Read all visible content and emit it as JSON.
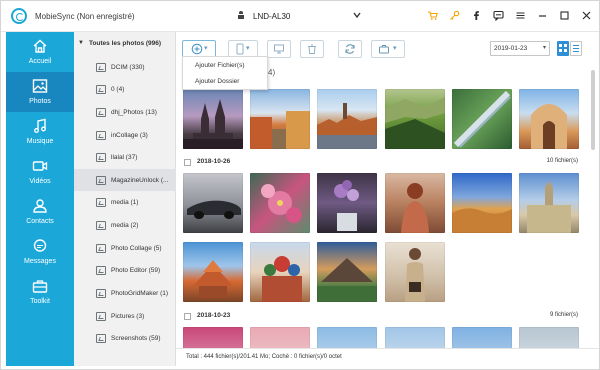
{
  "app": {
    "title": "MobieSync (Non enregistré)",
    "device_name": "LND-AL30",
    "top_icons": [
      "cart-icon",
      "key-icon",
      "facebook-icon",
      "feedback-icon",
      "menu-icon",
      "minimize-icon",
      "maximize-icon",
      "close-icon"
    ]
  },
  "nav": {
    "items": [
      {
        "label": "Accueil",
        "icon": "home-icon"
      },
      {
        "label": "Photos",
        "icon": "photos-icon"
      },
      {
        "label": "Musique",
        "icon": "music-icon"
      },
      {
        "label": "Vidéos",
        "icon": "video-icon"
      },
      {
        "label": "Contacts",
        "icon": "contacts-icon"
      },
      {
        "label": "Messages",
        "icon": "messages-icon"
      },
      {
        "label": "Toolkit",
        "icon": "toolkit-icon"
      }
    ],
    "active_index": 1,
    "colors": {
      "bg": "#1ba7d8",
      "active": "#1887bf"
    }
  },
  "folders": {
    "header": "Toutes les photos (996)",
    "items": [
      {
        "label": "DCIM (330)"
      },
      {
        "label": "0 (4)"
      },
      {
        "label": "dhj_Photos (13)"
      },
      {
        "label": "inCollage (3)"
      },
      {
        "label": "llalal (37)"
      },
      {
        "label": "MagazineUnlock (..."
      },
      {
        "label": "media (1)"
      },
      {
        "label": "media (2)"
      },
      {
        "label": "Photo Collage (5)"
      },
      {
        "label": "Photo Editor (59)"
      },
      {
        "label": "PhotoGridMaker (1)"
      },
      {
        "label": "Pictures (3)"
      },
      {
        "label": "Screenshots (59)"
      }
    ],
    "selected_index": 5
  },
  "toolbar": {
    "date_value": "2019-01-23",
    "add_menu": [
      "Ajouter Fichier(s)",
      "Ajouter Dossier"
    ],
    "hidden_count_fragment": "4)"
  },
  "groups": [
    {
      "date": "2018-10-26",
      "count": "10 fichier(s)"
    },
    {
      "date": "2018-10-23",
      "count": "9 fichier(s)"
    }
  ],
  "status": {
    "text": "Total : 444 fichier(s)/201.41 Mo; Coché : 0 fichier(s)/0 octet"
  }
}
